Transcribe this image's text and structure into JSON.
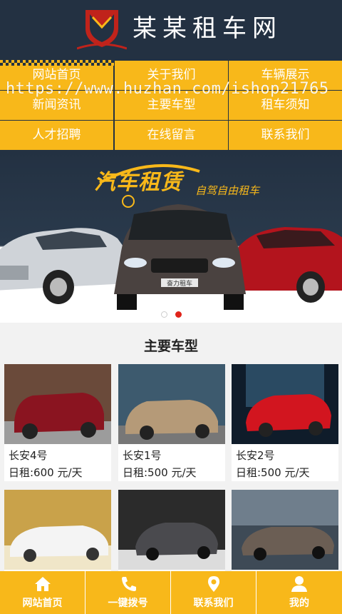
{
  "header": {
    "site_title": "某某租车网",
    "logo_icon": "shield-logo-icon"
  },
  "nav": {
    "items": [
      {
        "label": "网站首页"
      },
      {
        "label": "关于我们"
      },
      {
        "label": "车辆展示"
      },
      {
        "label": "新闻资讯"
      },
      {
        "label": "主要车型"
      },
      {
        "label": "租车须知"
      },
      {
        "label": "人才招聘"
      },
      {
        "label": "在线留言"
      },
      {
        "label": "联系我们"
      }
    ]
  },
  "watermark": "https://www.huzhan.com/ishop21765",
  "banner": {
    "brand_text": "汽车租赁",
    "slogan": "自驾自由租车",
    "plate_text": "奋力租车",
    "slides": 2,
    "active_slide": 2
  },
  "section": {
    "title": "主要车型",
    "cars": [
      {
        "name": "长安4号",
        "price": "日租:600 元/天"
      },
      {
        "name": "长安1号",
        "price": "日租:500 元/天"
      },
      {
        "name": "长安2号",
        "price": "日租:500 元/天"
      }
    ]
  },
  "bottom_bar": {
    "items": [
      {
        "label": "网站首页",
        "icon": "home-icon"
      },
      {
        "label": "一键拨号",
        "icon": "phone-icon"
      },
      {
        "label": "联系我们",
        "icon": "location-icon"
      },
      {
        "label": "我的",
        "icon": "user-icon"
      }
    ]
  },
  "colors": {
    "accent": "#f8b81a",
    "header_bg": "#233142"
  }
}
